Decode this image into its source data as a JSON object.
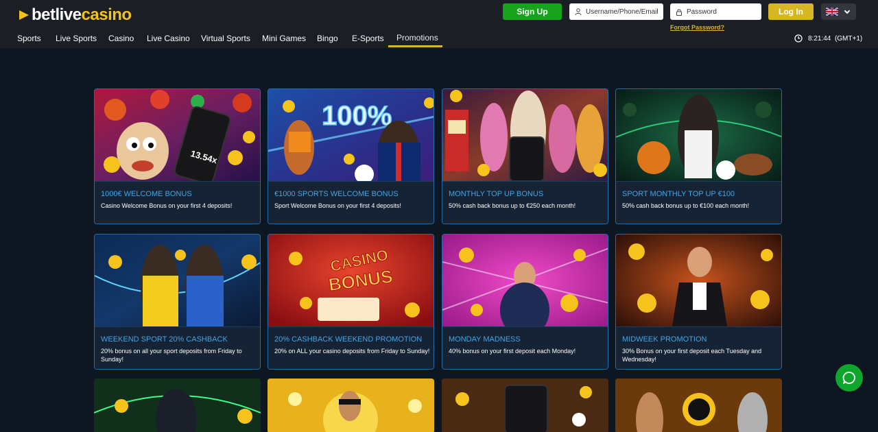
{
  "header": {
    "logo_bet": "betlive",
    "logo_casino": "casino",
    "signup_label": "Sign Up",
    "username_placeholder": "Username/Phone/Email",
    "password_placeholder": "Password",
    "login_label": "Log In",
    "forgot_label": "Forgot Password?",
    "language": "English (UK flag)",
    "clock_time": "8:21:44",
    "clock_zone": "(GMT+1)"
  },
  "nav": {
    "items": [
      "Sports",
      "Live Sports",
      "Casino",
      "Live Casino",
      "Virtual Sports",
      "Mini Games",
      "Bingo",
      "E-Sports",
      "Promotions"
    ],
    "active": "Promotions"
  },
  "promotions": [
    {
      "title": "1000€ WELCOME BONUS",
      "desc": "Casino Welcome Bonus on your first 4 deposits!"
    },
    {
      "title": "€1000 SPORTS WELCOME BONUS",
      "desc": "Sport Welcome Bonus on your first 4 deposits!"
    },
    {
      "title": "MONTHLY TOP UP BONUS",
      "desc": "50% cash back bonus up to €250 each month!"
    },
    {
      "title": "SPORT MONTHLY TOP UP €100",
      "desc": "50% cash back bonus up to €100 each month!"
    },
    {
      "title": "WEEKEND SPORT 20% CASHBACK",
      "desc": "20% bonus on all your sport deposits from Friday to Sunday!"
    },
    {
      "title": "20% CASHBACK WEEKEND PROMOTION",
      "desc": "20% on ALL your casino deposits from Friday to Sunday!"
    },
    {
      "title": "MONDAY MADNESS",
      "desc": "40% bonus on your first deposit each Monday!"
    },
    {
      "title": "MIDWEEK PROMOTION",
      "desc": "30% Bonus on your first deposit each Tuesday and Wednesday!"
    }
  ],
  "banner_text": {
    "pct": "100%",
    "casino": "CASINO",
    "bonus": "BONUS",
    "multiplier": "13.54x"
  },
  "colors": {
    "accent_gold": "#d7b625",
    "signup_green": "#19a21d",
    "title_blue": "#3ea6e8",
    "card_border": "#1f6fb0",
    "chat_green": "#10a52d"
  },
  "icons": [
    "user-icon",
    "lock-icon",
    "chevron-down-icon",
    "clock-icon",
    "chat-icon"
  ]
}
